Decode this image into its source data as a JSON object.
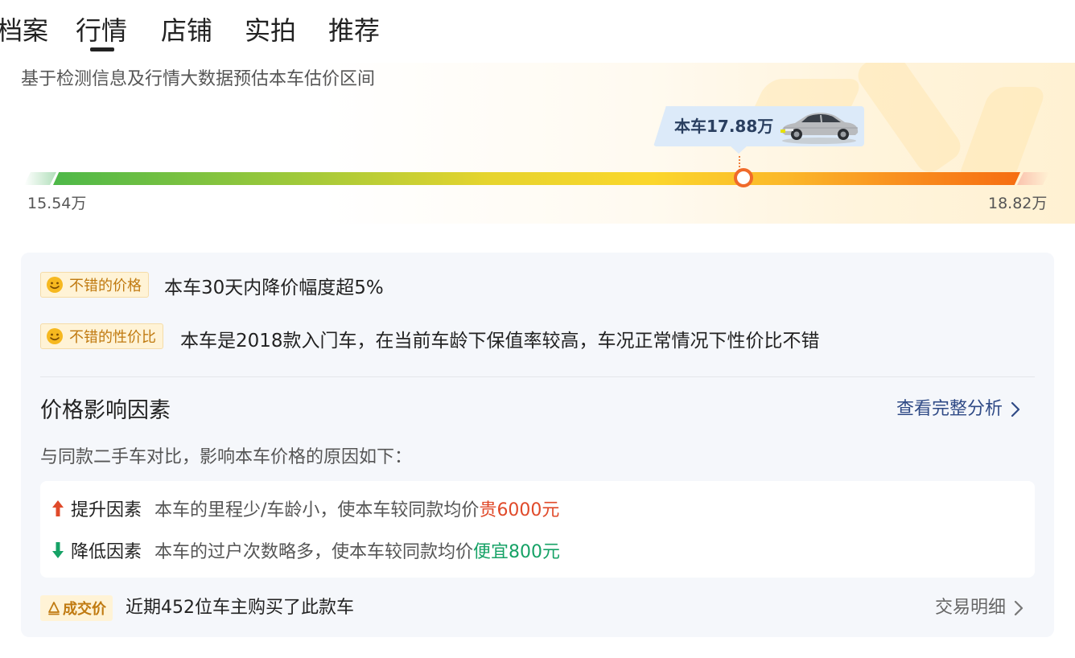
{
  "tabs": [
    {
      "label": "档案"
    },
    {
      "label": "行情",
      "active": true
    },
    {
      "label": "店铺"
    },
    {
      "label": "实拍"
    },
    {
      "label": "推荐"
    }
  ],
  "price_estimate": {
    "subtitle": "基于检测信息及行情大数据预估本车估价区间",
    "current_label": "本车17.88万",
    "min_label": "15.54万",
    "max_label": "18.82万",
    "range_min": 15.54,
    "range_max": 18.82,
    "current_value": 17.88
  },
  "advantages": [
    {
      "tag": "不错的价格",
      "text": "本车30天内降价幅度超5%"
    },
    {
      "tag": "不错的性价比",
      "text": "本车是2018款入门车，在当前车龄下保值率较高，车况正常情况下性价比不错"
    }
  ],
  "factors_section": {
    "title": "价格影响因素",
    "link_label": "查看完整分析",
    "description": "与同款二手车对比，影响本车价格的原因如下：",
    "factors": [
      {
        "name": "提升因素",
        "text": "本车的里程少/车龄小，使本车较同款均价",
        "amount": "贵6000元",
        "direction": "up"
      },
      {
        "name": "降低因素",
        "text": "本车的过户次数略多，使本车较同款均价",
        "amount": "便宜800元",
        "direction": "down"
      }
    ]
  },
  "deal": {
    "tag": "成交价",
    "text": "近期452位车主购买了此款车",
    "link_label": "交易明细"
  },
  "colors": {
    "accent_up": "#e04a2a",
    "accent_down": "#16a266",
    "link": "#2f4a86",
    "tag_bg": "#fff3d6",
    "tag_text": "#c07a10",
    "marker": "#f06a2a"
  },
  "icons": {
    "smile": "smile-icon",
    "car": "car-icon",
    "arrow_up": "arrow-up-icon",
    "arrow_down": "arrow-down-icon",
    "chevron": "chevron-right-icon",
    "deal": "deal-icon"
  }
}
